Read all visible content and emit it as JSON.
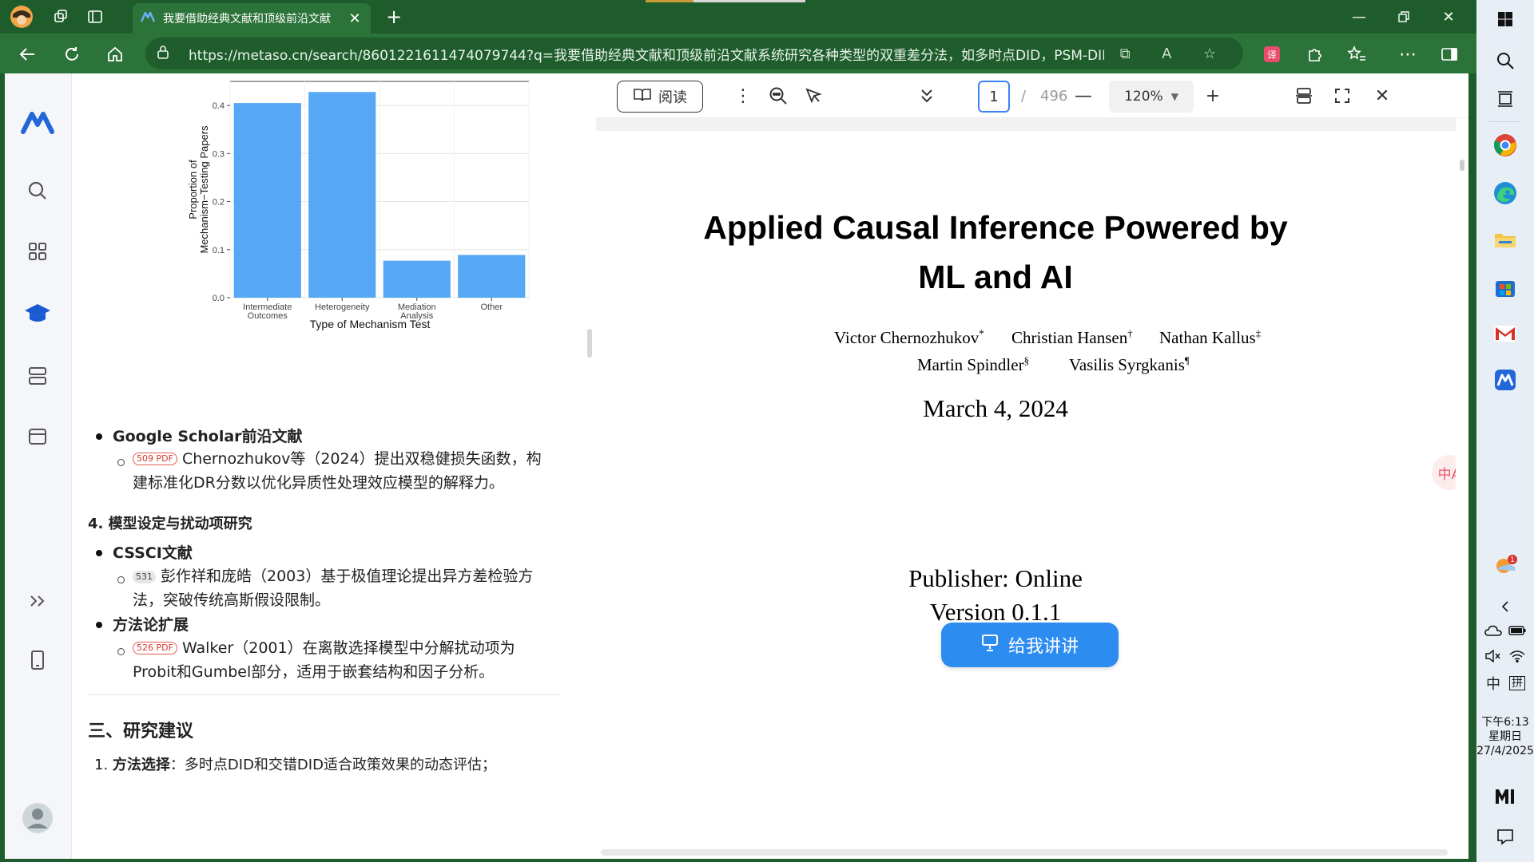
{
  "browser": {
    "tab_title": "我要借助经典文献和顶级前沿文献",
    "url": "https://metaso.cn/search/8601221611474079744?q=我要借助经典文献和顶级前沿文献系统研究各种类型的双重差分法，如多时点DID，PSM-DID，..."
  },
  "chart_data": {
    "type": "bar",
    "categories": [
      "Intermediate Outcomes",
      "Heterogeneity",
      "Mediation Analysis",
      "Other"
    ],
    "category_lines": [
      [
        "Intermediate",
        "Outcomes"
      ],
      [
        "Heterogeneity"
      ],
      [
        "Mediation",
        "Analysis"
      ],
      [
        "Other"
      ]
    ],
    "values": [
      0.405,
      0.428,
      0.077,
      0.089
    ],
    "xlabel": "Type of Mechanism Test",
    "ylabel_lines": [
      "Proportion of",
      "Mechanism−Testing Papers"
    ],
    "ylim": [
      0,
      0.45
    ],
    "yticks": [
      0.0,
      0.1,
      0.2,
      0.3,
      0.4
    ],
    "ytick_labels": [
      "0.0",
      "0.1",
      "0.2",
      "0.3",
      "0.4"
    ],
    "grid": true,
    "bar_color": "#56a8f5"
  },
  "left": {
    "sec1_title": "Google Scholar前沿文献",
    "item1_tag": "509 PDF",
    "item1_line1": "Chernozhukov等（2024）提出双稳健损失函数，构",
    "item1_line2": "建标准化DR分数以优化异质性处理效应模型的解释力。",
    "heading4": "4. 模型设定与扰动项研究",
    "sec2_title": "CSSCI文献",
    "item2_badge": "531",
    "item2_line1": "彭作祥和庞皓（2003）基于极值理论提出异方差检验方",
    "item2_line2": "法，突破传统高斯假设限制。",
    "sec3_title": "方法论扩展",
    "item3_tag": "526 PDF",
    "item3_line1": "Walker（2001）在离散选择模型中分解扰动项为",
    "item3_line2": "Probit和Gumbel部分，适用于嵌套结构和因子分析。",
    "heading3": "三、研究建议",
    "rec1_bold": "方法选择",
    "rec1_text": "：多时点DID和交错DID适合政策效果的动态评估；"
  },
  "pdf": {
    "read_label": "阅读",
    "page_current": "1",
    "page_sep": "/",
    "page_total": "496",
    "zoom": "120%",
    "title_line1": "Applied Causal Inference Powered by",
    "title_line2": "ML and AI",
    "authors": [
      {
        "name": "Victor Chernozhukov",
        "mark": "*"
      },
      {
        "name": "Christian Hansen",
        "mark": "†"
      },
      {
        "name": "Nathan Kallus",
        "mark": "‡"
      },
      {
        "name": "Martin Spindler",
        "mark": "§"
      },
      {
        "name": "Vasilis Syrgkanis",
        "mark": "¶"
      }
    ],
    "date": "March 4, 2024",
    "publisher": "Publisher: Online",
    "version": "Version 0.1.1",
    "explain_button": "给我讲讲",
    "float_translate": "中A"
  },
  "taskbar": {
    "ime_lang": "中",
    "ime_mode": "拼",
    "time": "下午6:13",
    "weekday": "星期日",
    "date": "27/4/2025",
    "notif_count": "1"
  },
  "colors": {
    "chrome_green": "#2c7339",
    "accent_blue": "#2d8cf0",
    "brand": "#2366d9"
  }
}
